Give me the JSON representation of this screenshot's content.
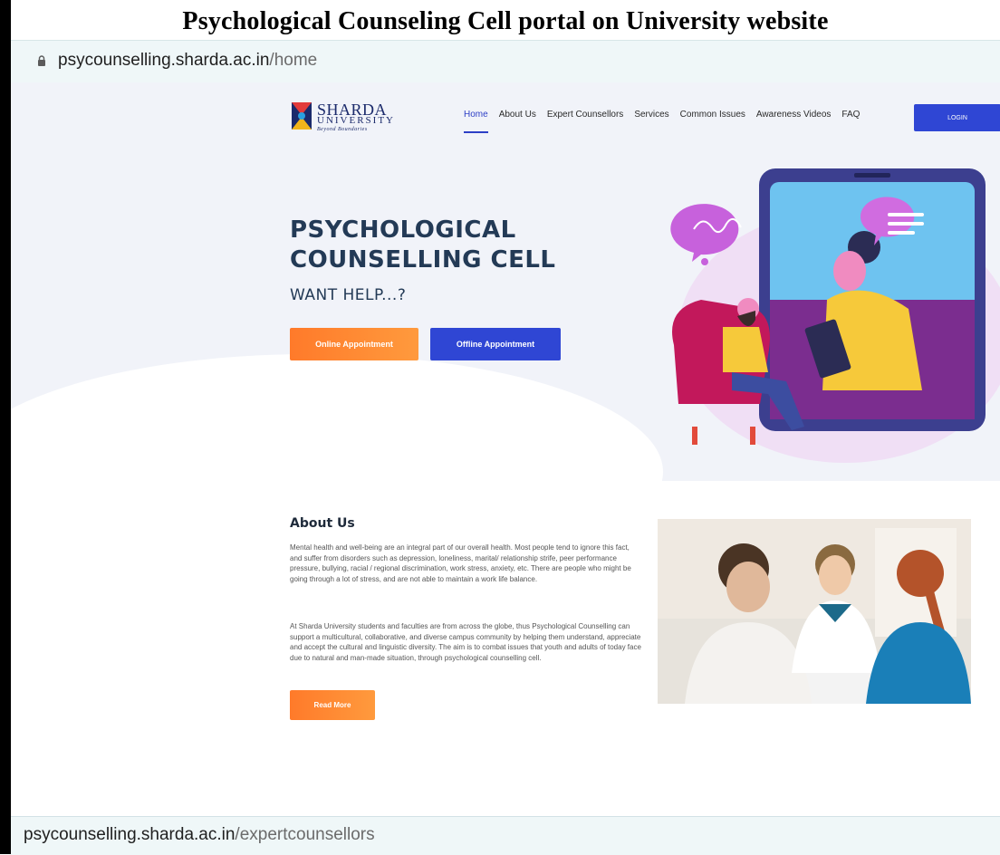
{
  "caption": "Psychological Counseling Cell portal on University website",
  "browser": {
    "url_host": "psycounselling.sharda.ac.in",
    "url_path": "/home"
  },
  "header": {
    "logo_line1": "SHARDA",
    "logo_line2": "UNIVERSITY",
    "logo_tagline": "Beyond Boundaries",
    "nav": [
      "Home",
      "About Us",
      "Expert Counsellors",
      "Services",
      "Common Issues",
      "Awareness Videos",
      "FAQ"
    ],
    "active_nav": "Home",
    "login_label": "LOGIN"
  },
  "hero": {
    "title_line1": "PSYCHOLOGICAL",
    "title_line2": "COUNSELLING CELL",
    "subtitle": "WANT HELP...?",
    "online_button": "Online Appointment",
    "offline_button": "Offline Appointment"
  },
  "about": {
    "title": "About Us",
    "paragraph1": "Mental health and well-being are an integral part of our overall health. Most people tend to ignore this fact, and suffer from disorders such as depression, loneliness, marital/ relationship strife, peer performance pressure, bullying, racial / regional discrimination, work stress, anxiety, etc. There are people who might be going through a lot of stress, and are not able to maintain a work life balance.",
    "paragraph2": "At Sharda University students and faculties are from across the globe, thus Psychological Counselling can support a multicultural, collaborative, and diverse campus community by helping them understand, appreciate and accept the cultural and linguistic diversity. The aim is to combat issues that youth and adults of today face due to natural and man-made situation, through psychological counselling cell.",
    "read_more": "Read More"
  },
  "status": {
    "host": "psycounselling.sharda.ac.in",
    "path": "/expertcounsellors"
  },
  "colors": {
    "primary_blue": "#2f46d4",
    "accent_orange": "#ff7a2a",
    "heading_navy": "#233a56"
  }
}
